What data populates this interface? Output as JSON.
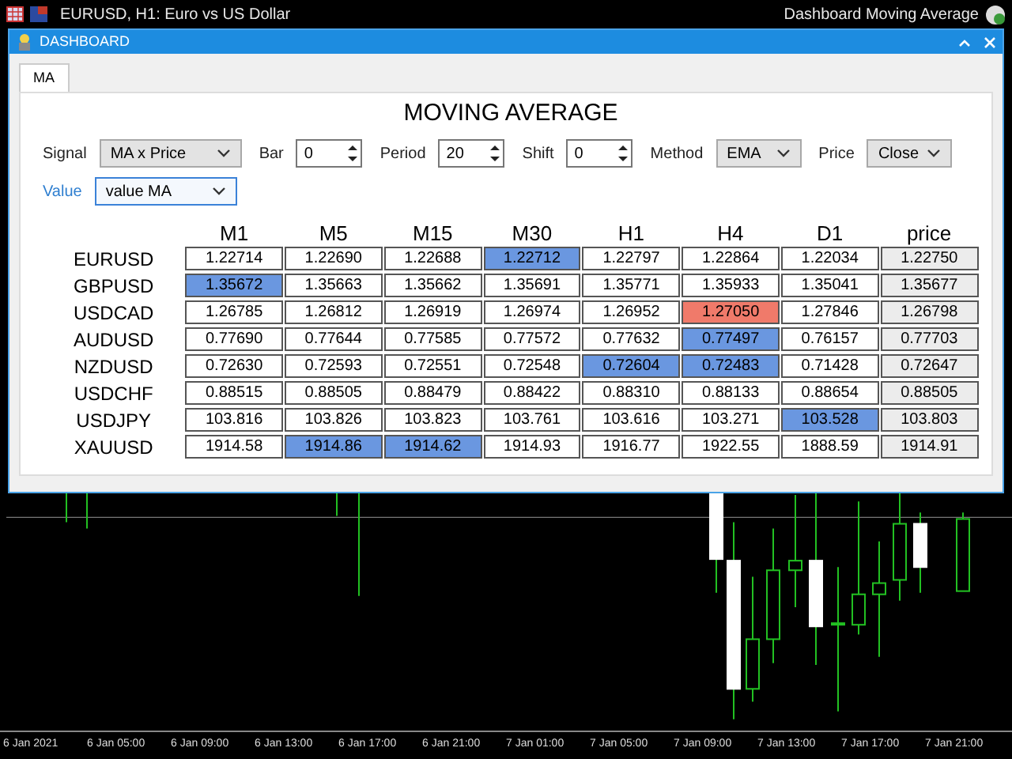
{
  "top_bar": {
    "chart_title": "EURUSD, H1:  Euro vs US Dollar",
    "indicator_name": "Dashboard Moving Average"
  },
  "dialog": {
    "title": "DASHBOARD"
  },
  "tabs": [
    {
      "label": "MA",
      "selected": true
    }
  ],
  "panel_title": "MOVING AVERAGE",
  "controls": [
    {
      "kind": "dropdown",
      "label": "Signal",
      "value": "MA x Price",
      "focused": false
    },
    {
      "kind": "spinner",
      "label": "Bar",
      "value": "0",
      "focused": false
    },
    {
      "kind": "spinner",
      "label": "Period",
      "value": "20",
      "focused": false
    },
    {
      "kind": "spinner",
      "label": "Shift",
      "value": "0",
      "focused": false
    },
    {
      "kind": "dropdown",
      "label": "Method",
      "value": "EMA",
      "focused": false
    },
    {
      "kind": "dropdown",
      "label": "Price",
      "value": "Close",
      "focused": false
    }
  ],
  "controls_second_row": [
    {
      "kind": "dropdown",
      "label": "Value",
      "value": "value MA",
      "focused": true
    }
  ],
  "table": {
    "columns": [
      "M1",
      "M5",
      "M15",
      "M30",
      "H1",
      "H4",
      "D1",
      "price"
    ],
    "rows": [
      {
        "symbol": "EURUSD",
        "cells": [
          {
            "value": "1.22714",
            "color": "#ffffff"
          },
          {
            "value": "1.22690",
            "color": "#ffffff"
          },
          {
            "value": "1.22688",
            "color": "#ffffff"
          },
          {
            "value": "1.22712",
            "color": "#6a97e0"
          },
          {
            "value": "1.22797",
            "color": "#ffffff"
          },
          {
            "value": "1.22864",
            "color": "#ffffff"
          },
          {
            "value": "1.22034",
            "color": "#ffffff"
          },
          {
            "value": "1.22750",
            "color": "#ececec"
          }
        ]
      },
      {
        "symbol": "GBPUSD",
        "cells": [
          {
            "value": "1.35672",
            "color": "#6a97e0"
          },
          {
            "value": "1.35663",
            "color": "#ffffff"
          },
          {
            "value": "1.35662",
            "color": "#ffffff"
          },
          {
            "value": "1.35691",
            "color": "#ffffff"
          },
          {
            "value": "1.35771",
            "color": "#ffffff"
          },
          {
            "value": "1.35933",
            "color": "#ffffff"
          },
          {
            "value": "1.35041",
            "color": "#ffffff"
          },
          {
            "value": "1.35677",
            "color": "#ececec"
          }
        ]
      },
      {
        "symbol": "USDCAD",
        "cells": [
          {
            "value": "1.26785",
            "color": "#ffffff"
          },
          {
            "value": "1.26812",
            "color": "#ffffff"
          },
          {
            "value": "1.26919",
            "color": "#ffffff"
          },
          {
            "value": "1.26974",
            "color": "#ffffff"
          },
          {
            "value": "1.26952",
            "color": "#ffffff"
          },
          {
            "value": "1.27050",
            "color": "#f07a6a"
          },
          {
            "value": "1.27846",
            "color": "#ffffff"
          },
          {
            "value": "1.26798",
            "color": "#ececec"
          }
        ]
      },
      {
        "symbol": "AUDUSD",
        "cells": [
          {
            "value": "0.77690",
            "color": "#ffffff"
          },
          {
            "value": "0.77644",
            "color": "#ffffff"
          },
          {
            "value": "0.77585",
            "color": "#ffffff"
          },
          {
            "value": "0.77572",
            "color": "#ffffff"
          },
          {
            "value": "0.77632",
            "color": "#ffffff"
          },
          {
            "value": "0.77497",
            "color": "#6a97e0"
          },
          {
            "value": "0.76157",
            "color": "#ffffff"
          },
          {
            "value": "0.77703",
            "color": "#ececec"
          }
        ]
      },
      {
        "symbol": "NZDUSD",
        "cells": [
          {
            "value": "0.72630",
            "color": "#ffffff"
          },
          {
            "value": "0.72593",
            "color": "#ffffff"
          },
          {
            "value": "0.72551",
            "color": "#ffffff"
          },
          {
            "value": "0.72548",
            "color": "#ffffff"
          },
          {
            "value": "0.72604",
            "color": "#6a97e0"
          },
          {
            "value": "0.72483",
            "color": "#6a97e0"
          },
          {
            "value": "0.71428",
            "color": "#ffffff"
          },
          {
            "value": "0.72647",
            "color": "#ececec"
          }
        ]
      },
      {
        "symbol": "USDCHF",
        "cells": [
          {
            "value": "0.88515",
            "color": "#ffffff"
          },
          {
            "value": "0.88505",
            "color": "#ffffff"
          },
          {
            "value": "0.88479",
            "color": "#ffffff"
          },
          {
            "value": "0.88422",
            "color": "#ffffff"
          },
          {
            "value": "0.88310",
            "color": "#ffffff"
          },
          {
            "value": "0.88133",
            "color": "#ffffff"
          },
          {
            "value": "0.88654",
            "color": "#ffffff"
          },
          {
            "value": "0.88505",
            "color": "#ececec"
          }
        ]
      },
      {
        "symbol": "USDJPY",
        "cells": [
          {
            "value": "103.816",
            "color": "#ffffff"
          },
          {
            "value": "103.826",
            "color": "#ffffff"
          },
          {
            "value": "103.823",
            "color": "#ffffff"
          },
          {
            "value": "103.761",
            "color": "#ffffff"
          },
          {
            "value": "103.616",
            "color": "#ffffff"
          },
          {
            "value": "103.271",
            "color": "#ffffff"
          },
          {
            "value": "103.528",
            "color": "#6a97e0"
          },
          {
            "value": "103.803",
            "color": "#ececec"
          }
        ]
      },
      {
        "symbol": "XAUUSD",
        "cells": [
          {
            "value": "1914.58",
            "color": "#ffffff"
          },
          {
            "value": "1914.86",
            "color": "#6a97e0"
          },
          {
            "value": "1914.62",
            "color": "#6a97e0"
          },
          {
            "value": "1914.93",
            "color": "#ffffff"
          },
          {
            "value": "1916.77",
            "color": "#ffffff"
          },
          {
            "value": "1922.55",
            "color": "#ffffff"
          },
          {
            "value": "1888.59",
            "color": "#ffffff"
          },
          {
            "value": "1914.91",
            "color": "#ececec"
          }
        ]
      }
    ]
  },
  "time_axis": [
    "6 Jan 2021",
    "6 Jan 05:00",
    "6 Jan 09:00",
    "6 Jan 13:00",
    "6 Jan 17:00",
    "6 Jan 21:00",
    "7 Jan 01:00",
    "7 Jan 05:00",
    "7 Jan 09:00",
    "7 Jan 13:00",
    "7 Jan 17:00",
    "7 Jan 21:00"
  ]
}
